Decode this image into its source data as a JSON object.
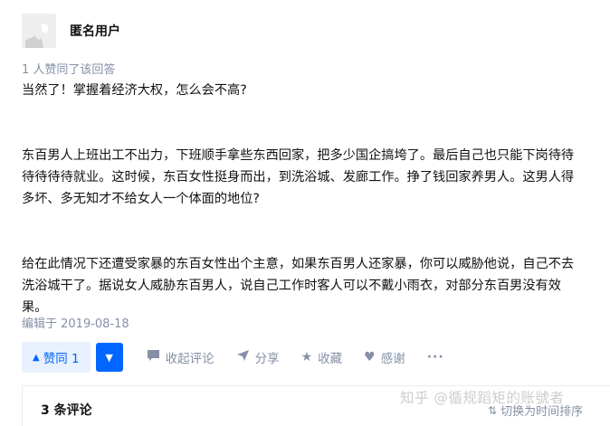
{
  "author": {
    "name": "匿名用户",
    "avatar_icon": "anonymous-avatar"
  },
  "answer": {
    "upvote_note": "1 人赞同了该回答",
    "paragraphs": [
      [
        "当然了！掌握着经济大权，怎么会不高?"
      ],
      [
        "东百男人上班出工不出力，下班顺手拿些东西回家，把多少国企搞垮了。最后自己也只能下岗待待",
        "待待待待就业。这时候，东百女性挺身而出，到洗浴城、发廊工作。挣了钱回家养男人。这男人得",
        "多坏、多无知才不给女人一个体面的地位?"
      ],
      [
        "给在此情况下还遭受家暴的东百女性出个主意，如果东百男人还家暴，你可以威胁他说，自己不去",
        "洗浴城干了。据说女人威胁东百男人，说自己工作时客人可以不戴小雨衣，对部分东百男没有效",
        "果。"
      ]
    ],
    "edit_date": "编辑于 2019-08-18"
  },
  "actions": {
    "upvote_label": "赞同 1",
    "upvote_icon": "triangle-up-icon",
    "downvote_icon": "triangle-down-icon",
    "collapse_comments": "收起评论",
    "share": "分享",
    "favorite": "收藏",
    "thanks": "感谢",
    "more_icon": "ellipsis-icon",
    "accent_color": "#0066ff"
  },
  "comments": {
    "count_label": "3 条评论",
    "sort_label": "切换为时间排序"
  },
  "watermark": "知乎 @循规蹈矩的账號者"
}
